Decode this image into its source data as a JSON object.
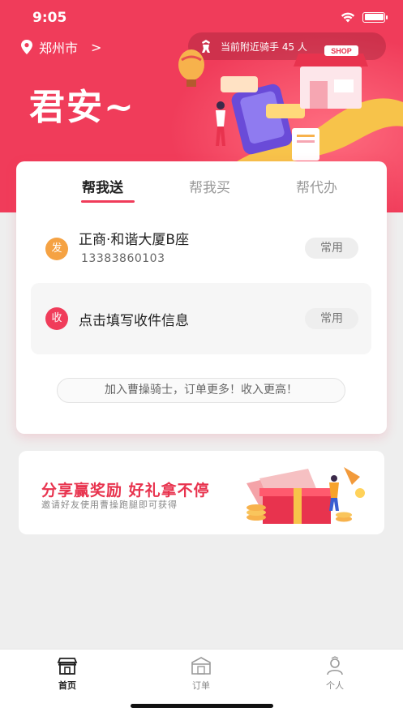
{
  "status": {
    "time": "9:05"
  },
  "header": {
    "city": "郑州市",
    "city_chevron": ">",
    "riders_text": "当前附近骑手 45 人",
    "greeting": "君安~",
    "shop_sign": "SHOP"
  },
  "tabs": [
    {
      "label": "帮我送",
      "active": true
    },
    {
      "label": "帮我买",
      "active": false
    },
    {
      "label": "帮代办",
      "active": false
    }
  ],
  "sender": {
    "badge": "发",
    "title": "正商·和谐大厦B座",
    "phone": "13383860103",
    "chip": "常用"
  },
  "receiver": {
    "badge": "收",
    "title": "点击填写收件信息",
    "chip": "常用"
  },
  "join_text": "加入曹操骑士，订单更多！收入更高！",
  "promo": {
    "title": "分享赢奖励 好礼拿不停",
    "subtitle": "邀请好友使用曹操跑腿即可获得"
  },
  "nav": [
    {
      "label": "首页",
      "icon": "home-shop-icon",
      "active": true
    },
    {
      "label": "订单",
      "icon": "order-box-icon",
      "active": false
    },
    {
      "label": "个人",
      "icon": "person-icon",
      "active": false
    }
  ],
  "colors": {
    "brand": "#f03c5a",
    "send_badge": "#f5a243"
  }
}
